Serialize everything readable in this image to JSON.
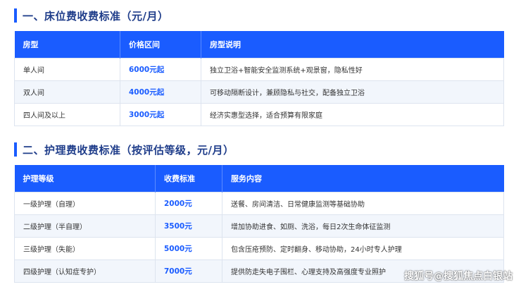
{
  "section1": {
    "title": "一、床位费收费标准（元/月）",
    "headers": [
      "房型",
      "价格区间",
      "房型说明"
    ],
    "rows": [
      [
        "单人间",
        "6000元起",
        "独立卫浴+智能安全监测系统+观景窗，隐私性好"
      ],
      [
        "双人间",
        "4000元起",
        "可移动隔断设计，兼顾隐私与社交，配备独立卫浴"
      ],
      [
        "四人间及以上",
        "3000元起",
        "经济实惠型选择，适合预算有限家庭"
      ]
    ]
  },
  "section2": {
    "title": "二、护理费收费标准（按评估等级，元/月）",
    "headers": [
      "护理等级",
      "收费标准",
      "服务内容"
    ],
    "rows": [
      [
        "一级护理（自理）",
        "2000元",
        "送餐、房间清洁、日常健康监测等基础协助"
      ],
      [
        "二级护理（半自理）",
        "3500元",
        "增加协助进食、如厕、洗浴，每日2次生命体征监测"
      ],
      [
        "三级护理（失能）",
        "5000元",
        "包含压疮预防、定时翻身、移动协助，24小时专人护理"
      ],
      [
        "四级护理（认知症专护）",
        "7000元",
        "提供防走失电子围栏、心理支持及高强度专业照护"
      ]
    ]
  },
  "watermark": "搜狐号@搜狐焦点白银站",
  "colors": {
    "accent": "#1a5cff",
    "title": "#1f3d8a",
    "stripe": "#f2f6fc"
  }
}
